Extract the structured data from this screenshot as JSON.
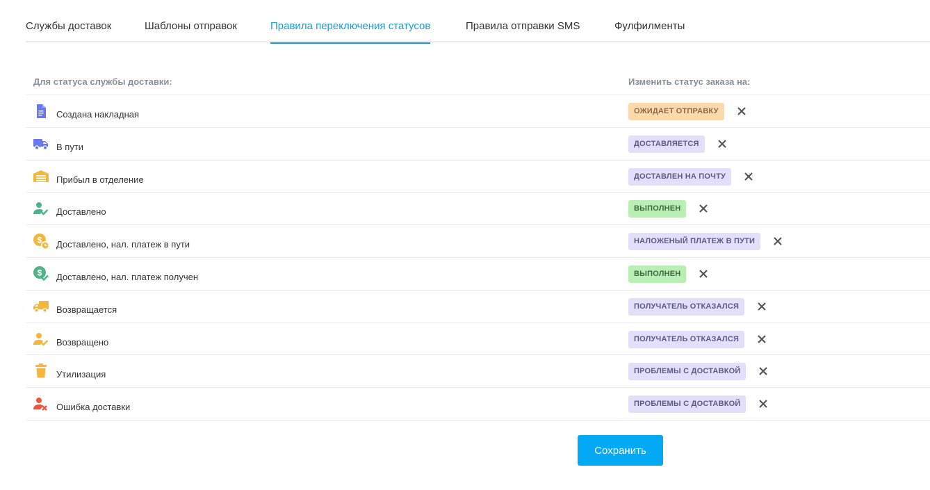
{
  "tabs": [
    {
      "label": "Службы доставок",
      "active": false
    },
    {
      "label": "Шаблоны отправок",
      "active": false
    },
    {
      "label": "Правила переключения статусов",
      "active": true
    },
    {
      "label": "Правила отправки SMS",
      "active": false
    },
    {
      "label": "Фулфилменты",
      "active": false
    }
  ],
  "table": {
    "col_delivery": "Для статуса службы доставки:",
    "col_order": "Изменить статус заказа на:",
    "rows": [
      {
        "icon": "document-icon",
        "label": "Создана накладная",
        "status": "ОЖИДАЕТ ОТПРАВКУ",
        "status_color": "orange"
      },
      {
        "icon": "truck-icon",
        "label": "В пути",
        "status": "ДОСТАВЛЯЕТСЯ",
        "status_color": "purple"
      },
      {
        "icon": "warehouse-icon",
        "label": "Прибыл в отделение",
        "status": "ДОСТАВЛЕН НА ПОЧТУ",
        "status_color": "purple"
      },
      {
        "icon": "user-check-icon",
        "label": "Доставлено",
        "status": "ВЫПОЛНЕН",
        "status_color": "green"
      },
      {
        "icon": "money-clock-icon",
        "label": "Доставлено, нал. платеж в пути",
        "status": "НАЛОЖЕНЫЙ ПЛАТЕЖ В ПУТИ",
        "status_color": "purple"
      },
      {
        "icon": "money-check-icon",
        "label": "Доставлено, нал. платеж получен",
        "status": "ВЫПОЛНЕН",
        "status_color": "green"
      },
      {
        "icon": "truck-return-icon",
        "label": "Возвращается",
        "status": "ПОЛУЧАТЕЛЬ ОТКАЗАЛСЯ",
        "status_color": "purple"
      },
      {
        "icon": "user-return-icon",
        "label": "Возвращено",
        "status": "ПОЛУЧАТЕЛЬ ОТКАЗАЛСЯ",
        "status_color": "purple"
      },
      {
        "icon": "trash-icon",
        "label": "Утилизация",
        "status": "ПРОБЛЕМЫ С ДОСТАВКОЙ",
        "status_color": "purple"
      },
      {
        "icon": "user-error-icon",
        "label": "Ошибка доставки",
        "status": "ПРОБЛЕМЫ С ДОСТАВКОЙ",
        "status_color": "purple"
      }
    ]
  },
  "save_label": "Сохранить",
  "colors": {
    "accent": "#03a9f4",
    "tab_active": "#1a9bd7",
    "icon_blue": "#6a78f0",
    "icon_orange": "#f2b73c",
    "icon_green": "#4fb38a",
    "icon_red": "#e9573f"
  }
}
